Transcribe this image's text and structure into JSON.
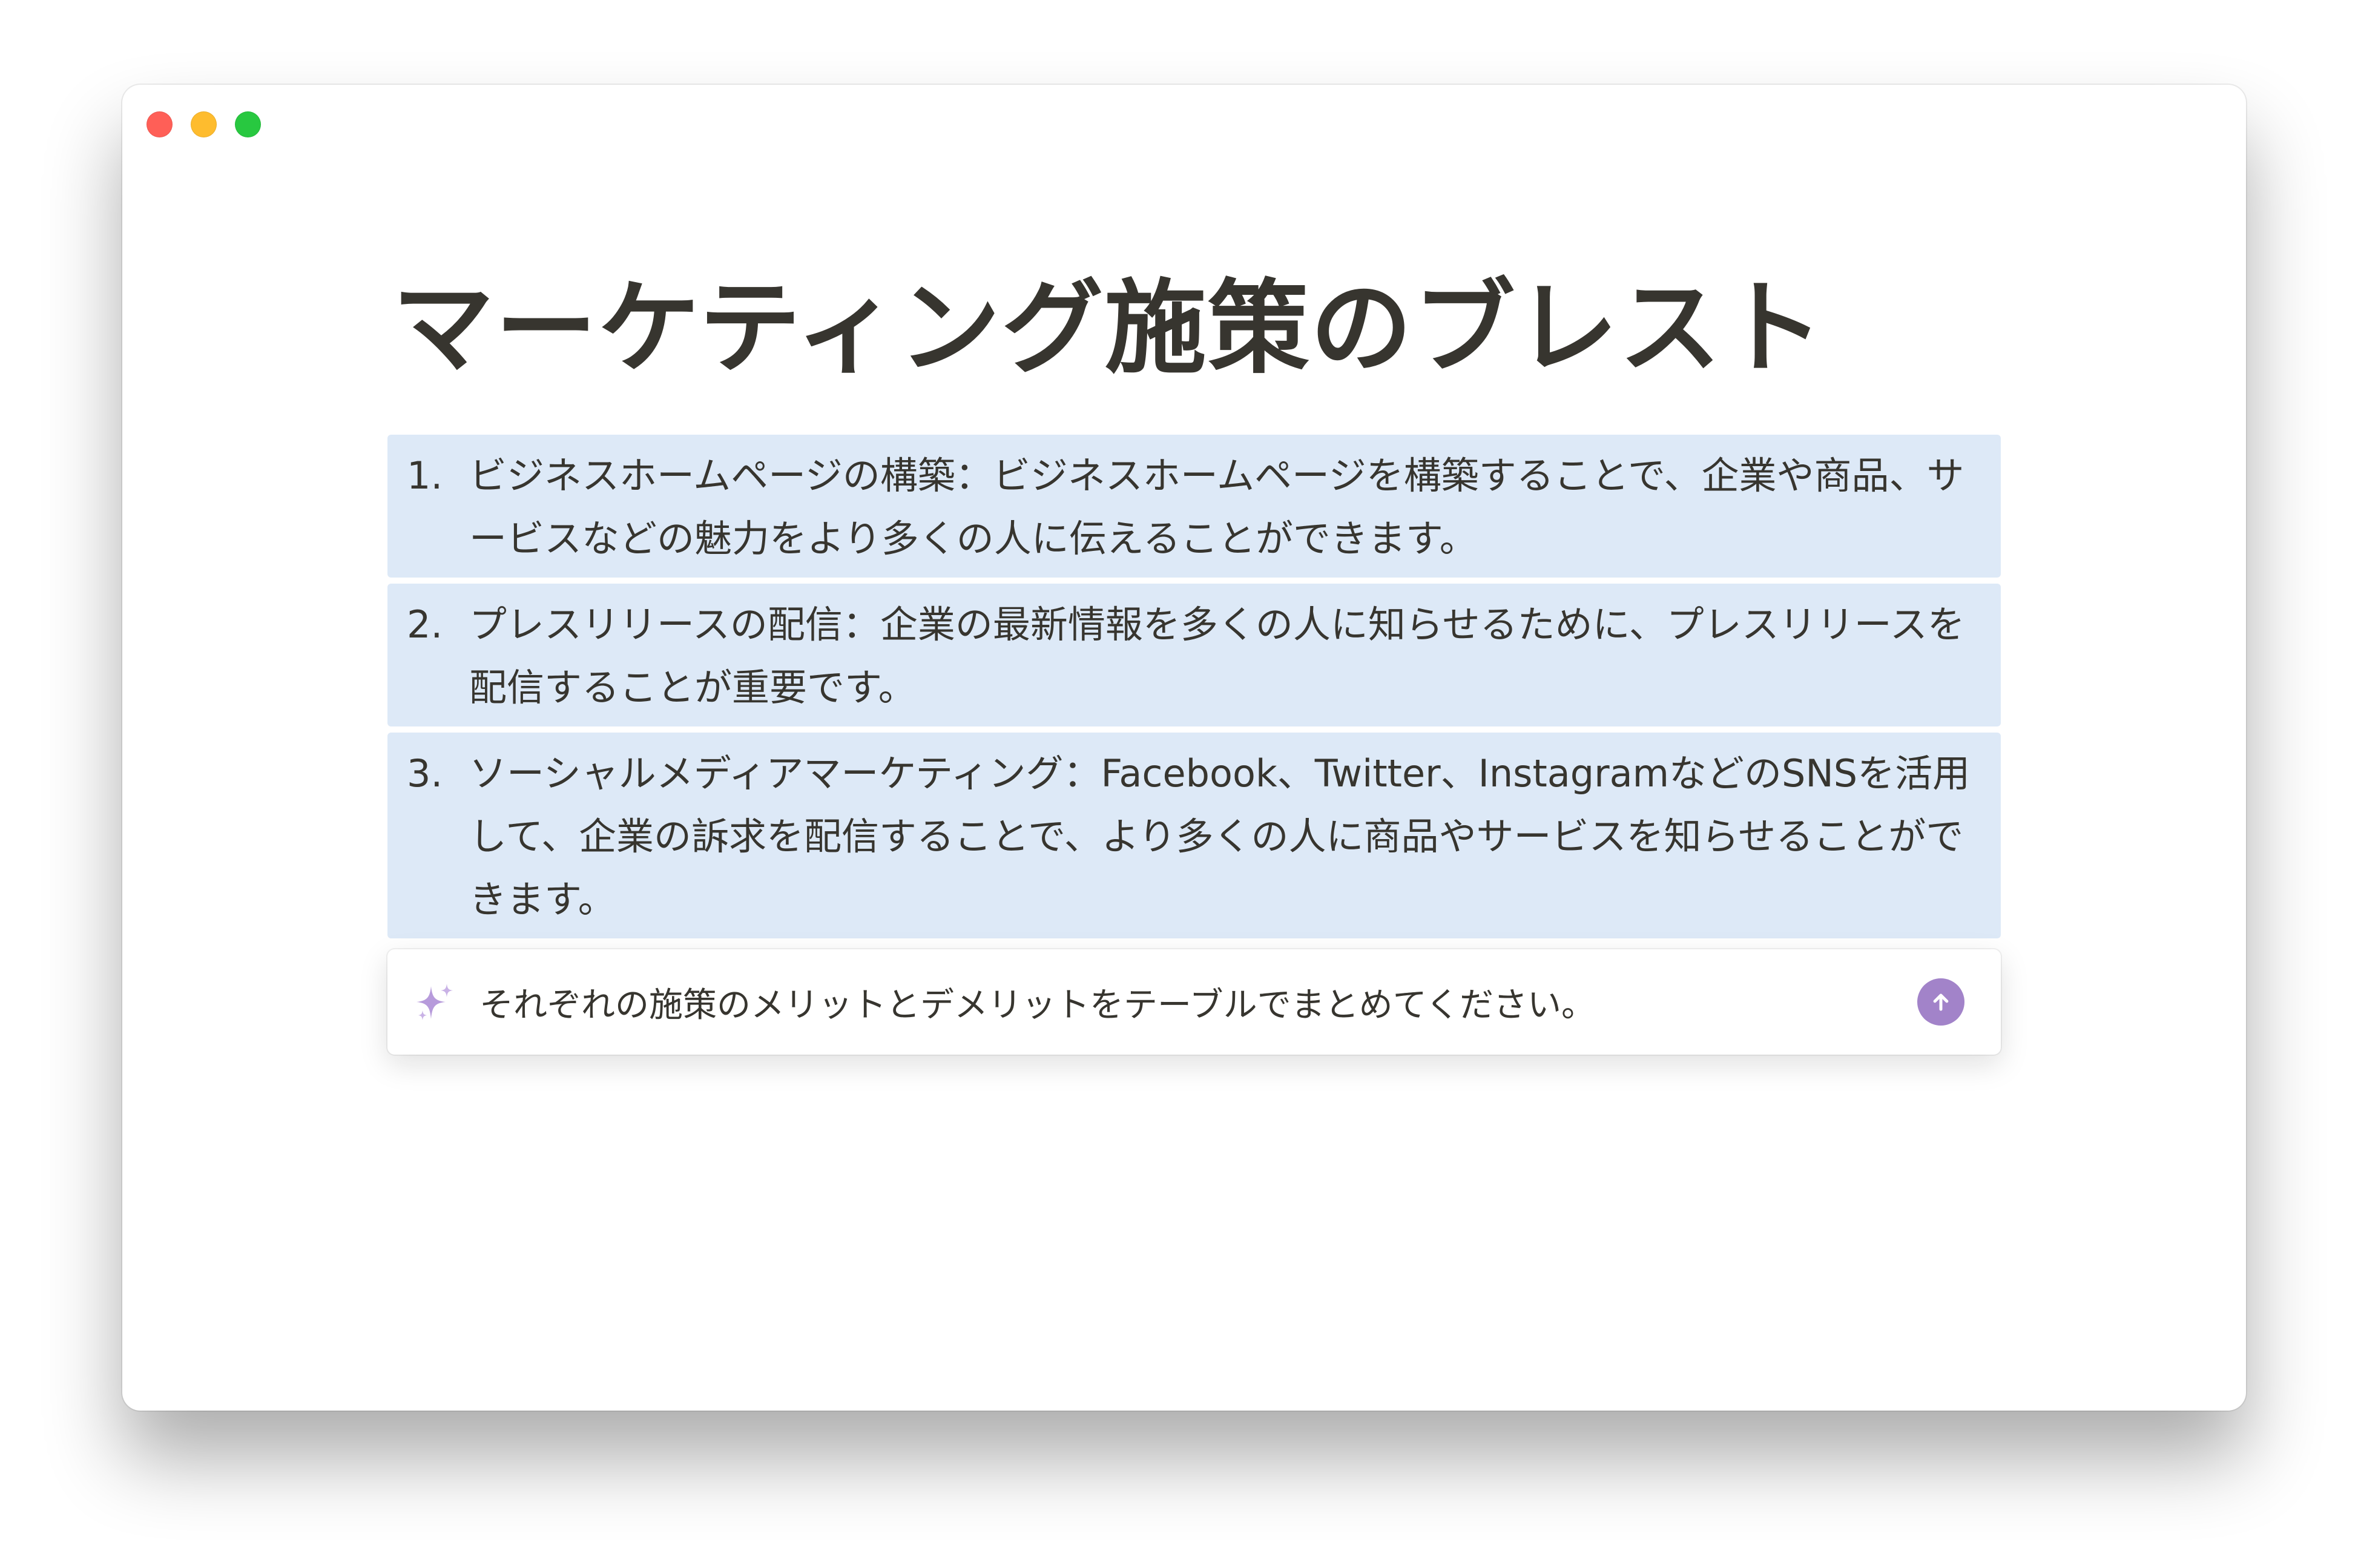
{
  "page": {
    "title": "マーケティング施策のブレスト"
  },
  "list": [
    {
      "number": "1.",
      "text": "ビジネスホームページの構築：ビジネスホームページを構築することで、企業や商品、サービスなどの魅力をより多くの人に伝えることができます。"
    },
    {
      "number": "2.",
      "text": "プレスリリースの配信：企業の最新情報を多くの人に知らせるために、プレスリリースを配信することが重要です。"
    },
    {
      "number": "3.",
      "text": "ソーシャルメディアマーケティング：Facebook、Twitter、InstagramなどのSNSを活用して、企業の訴求を配信することで、より多くの人に商品やサービスを知らせることができます。"
    }
  ],
  "ai_prompt": {
    "value": "それぞれの施策のメリットとデメリットをテーブルでまとめてください。",
    "icon": "sparkle-icon",
    "send_icon": "arrow-up-icon",
    "accent_color": "#a283c9"
  },
  "colors": {
    "highlight": "#dde9f7",
    "text": "#37352f"
  }
}
